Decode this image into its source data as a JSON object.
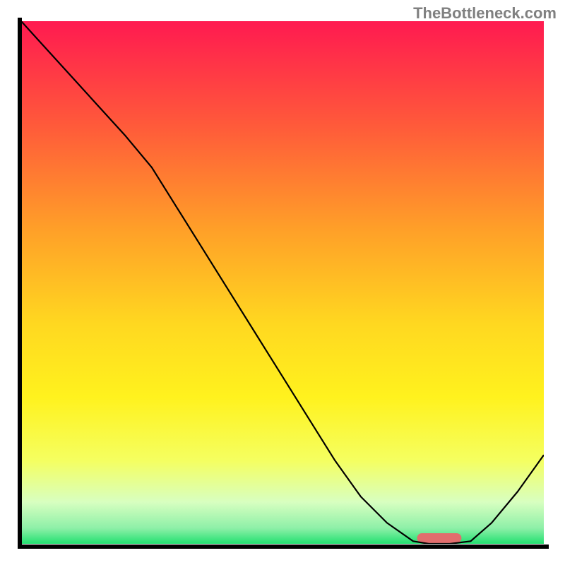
{
  "watermark": "TheBottleneck.com",
  "chart_data": {
    "type": "line",
    "title": "",
    "xlabel": "",
    "ylabel": "",
    "x": [
      0.0,
      0.05,
      0.1,
      0.15,
      0.2,
      0.25,
      0.3,
      0.35,
      0.4,
      0.45,
      0.5,
      0.55,
      0.6,
      0.65,
      0.7,
      0.75,
      0.78,
      0.82,
      0.86,
      0.9,
      0.95,
      1.0
    ],
    "y": [
      1.0,
      0.945,
      0.89,
      0.835,
      0.78,
      0.72,
      0.64,
      0.56,
      0.48,
      0.4,
      0.32,
      0.24,
      0.16,
      0.09,
      0.04,
      0.005,
      0.0,
      0.0,
      0.005,
      0.04,
      0.1,
      0.17
    ],
    "xlim": [
      0,
      1
    ],
    "ylim": [
      0,
      1
    ],
    "background_gradient": {
      "stops": [
        {
          "pos": 0.0,
          "color": "#ff1a50"
        },
        {
          "pos": 0.2,
          "color": "#ff5a3a"
        },
        {
          "pos": 0.4,
          "color": "#ffa028"
        },
        {
          "pos": 0.58,
          "color": "#ffd820"
        },
        {
          "pos": 0.72,
          "color": "#fff21e"
        },
        {
          "pos": 0.84,
          "color": "#f5ff60"
        },
        {
          "pos": 0.92,
          "color": "#d8ffc0"
        },
        {
          "pos": 0.97,
          "color": "#8ef0a8"
        },
        {
          "pos": 1.0,
          "color": "#22e070"
        }
      ]
    },
    "marker": {
      "x_center": 0.8,
      "width": 0.085,
      "y": 0.0,
      "color": "#e26d6d"
    },
    "grid": false,
    "legend": false
  }
}
